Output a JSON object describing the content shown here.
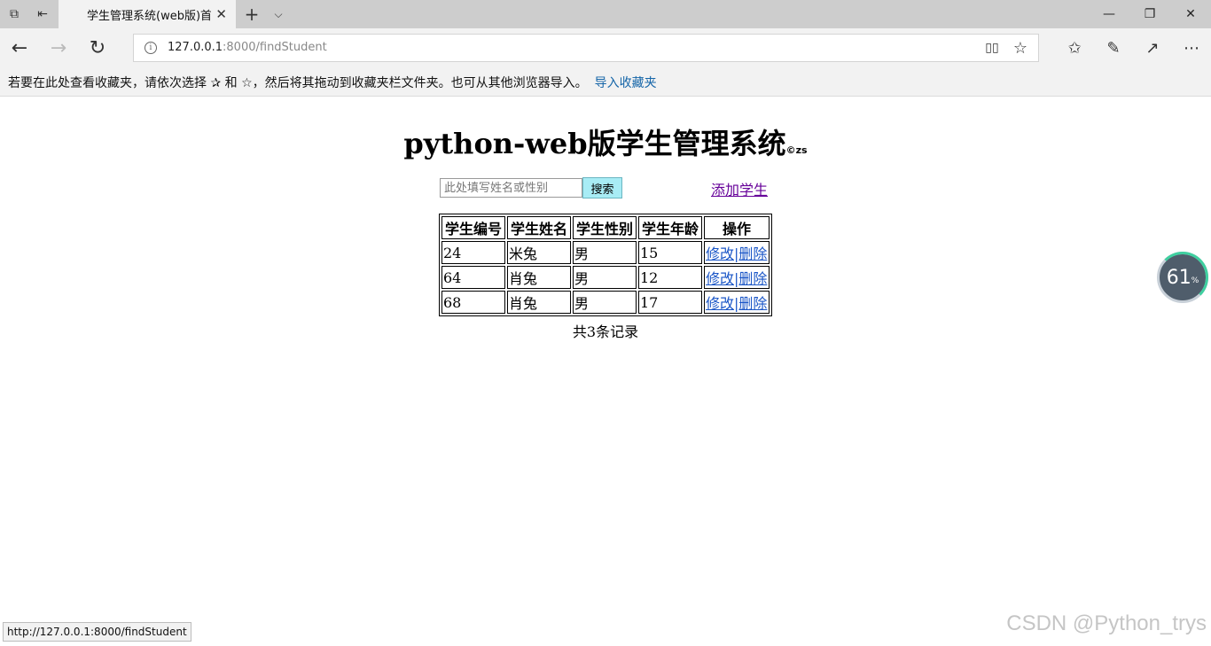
{
  "browser": {
    "tab_title": "学生管理系统(web版)首",
    "address": {
      "host": "127.0.0.1",
      "rest": ":8000/findStudent"
    },
    "favbar": {
      "hint": "若要在此处查看收藏夹，请依次选择 ✰ 和 ☆，然后将其拖动到收藏夹栏文件夹。也可从其他浏览器导入。",
      "import_link": "导入收藏夹"
    },
    "status_url": "http://127.0.0.1:8000/findStudent",
    "accent": "#1565a8"
  },
  "page": {
    "title": "python-web版学生管理系统",
    "title_sup": "©zs",
    "search": {
      "placeholder": "此处填写姓名或性别",
      "value": "",
      "button": "搜索"
    },
    "add_link": "添加学生",
    "table": {
      "headers": [
        "学生编号",
        "学生姓名",
        "学生性别",
        "学生年龄",
        "操作"
      ],
      "rows": [
        {
          "id": "24",
          "name": "米兔",
          "gender": "男",
          "age": "15",
          "edit": "修改",
          "sep": "|",
          "delete": "删除"
        },
        {
          "id": "64",
          "name": "肖兔",
          "gender": "男",
          "age": "12",
          "edit": "修改",
          "sep": "|",
          "delete": "删除"
        },
        {
          "id": "68",
          "name": "肖兔",
          "gender": "男",
          "age": "17",
          "edit": "修改",
          "sep": "|",
          "delete": "删除"
        }
      ]
    },
    "record_count": "共3条记录"
  },
  "widget": {
    "value": "61",
    "unit": "%"
  },
  "watermark": "CSDN @Python_trys",
  "icons": {
    "tab_manager": "⧉",
    "set_aside": "⇤",
    "close": "✕",
    "new_tab": "+",
    "tab_menu": "⌵",
    "minimize": "—",
    "restore": "❐",
    "win_close": "✕",
    "back": "←",
    "forward": "→",
    "refresh": "↻",
    "info": "i",
    "reading_view": "▯▯",
    "favorite": "☆",
    "favorites_list": "✩",
    "pen": "✎",
    "share": "↗",
    "more": "⋯"
  }
}
